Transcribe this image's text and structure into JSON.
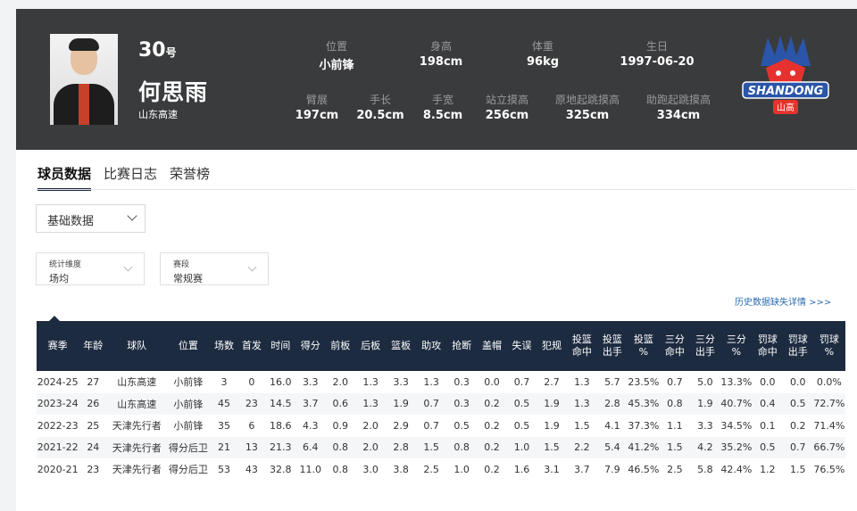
{
  "player": {
    "number": "30",
    "number_suffix": "号",
    "name": "何思雨",
    "team": "山东高速"
  },
  "stats": [
    {
      "label": "位置",
      "value": "小前锋"
    },
    {
      "label": "身高",
      "value": "198cm"
    },
    {
      "label": "体重",
      "value": "96kg"
    },
    {
      "label": "生日",
      "value": "1997-06-20"
    },
    {
      "label": "臂展",
      "value": "197cm"
    },
    {
      "label": "手长",
      "value": "20.5cm"
    },
    {
      "label": "手宽",
      "value": "8.5cm"
    },
    {
      "label": "站立摸高",
      "value": "256cm"
    },
    {
      "label": "原地起跳摸高",
      "value": "325cm"
    },
    {
      "label": "助跑起跳摸高",
      "value": "334cm"
    }
  ],
  "logo": {
    "text": "SHANDONG",
    "sub": "山高",
    "color": "#e6322e"
  },
  "tabs": [
    "球员数据",
    "比赛日志",
    "荣誉榜"
  ],
  "data_type_select": "基础数据",
  "filters": [
    {
      "label": "统计维度",
      "value": "场均"
    },
    {
      "label": "赛段",
      "value": "常规赛"
    }
  ],
  "history_link": "历史数据缺失详情 >>>",
  "table": {
    "headers": [
      "赛季",
      "年龄",
      "球队",
      "位置",
      "场数",
      "首发",
      "时间",
      "得分",
      "前板",
      "后板",
      "篮板",
      "助攻",
      "抢断",
      "盖帽",
      "失误",
      "犯规",
      "投篮命中",
      "投篮出手",
      "投篮%",
      "三分命中",
      "三分出手",
      "三分%",
      "罚球命中",
      "罚球出手",
      "罚球%"
    ],
    "rows": [
      [
        "2024-25",
        "27",
        "山东高速",
        "小前锋",
        "3",
        "0",
        "16.0",
        "3.3",
        "2.0",
        "1.3",
        "3.3",
        "1.3",
        "0.3",
        "0.0",
        "0.7",
        "2.7",
        "1.3",
        "5.7",
        "23.5%",
        "0.7",
        "5.0",
        "13.3%",
        "0.0",
        "0.0",
        "0.0%"
      ],
      [
        "2023-24",
        "26",
        "山东高速",
        "小前锋",
        "45",
        "23",
        "14.5",
        "3.7",
        "0.6",
        "1.3",
        "1.9",
        "0.7",
        "0.3",
        "0.2",
        "0.5",
        "1.9",
        "1.3",
        "2.8",
        "45.3%",
        "0.8",
        "1.9",
        "40.7%",
        "0.4",
        "0.5",
        "72.7%"
      ],
      [
        "2022-23",
        "25",
        "天津先行者",
        "小前锋",
        "35",
        "6",
        "18.6",
        "4.3",
        "0.9",
        "2.0",
        "2.9",
        "0.7",
        "0.5",
        "0.2",
        "0.5",
        "1.9",
        "1.5",
        "4.1",
        "37.3%",
        "1.1",
        "3.3",
        "34.5%",
        "0.1",
        "0.2",
        "71.4%"
      ],
      [
        "2021-22",
        "24",
        "天津先行者",
        "得分后卫",
        "21",
        "13",
        "21.3",
        "6.4",
        "0.8",
        "2.0",
        "2.8",
        "1.5",
        "0.8",
        "0.2",
        "1.0",
        "1.5",
        "2.2",
        "5.4",
        "41.2%",
        "1.5",
        "4.2",
        "35.2%",
        "0.5",
        "0.7",
        "66.7%"
      ],
      [
        "2020-21",
        "23",
        "天津先行者",
        "得分后卫",
        "53",
        "43",
        "32.8",
        "11.0",
        "0.8",
        "3.0",
        "3.8",
        "2.5",
        "1.0",
        "0.2",
        "1.6",
        "3.1",
        "3.7",
        "7.9",
        "46.5%",
        "2.5",
        "5.8",
        "42.4%",
        "1.2",
        "1.5",
        "76.5%"
      ]
    ]
  }
}
